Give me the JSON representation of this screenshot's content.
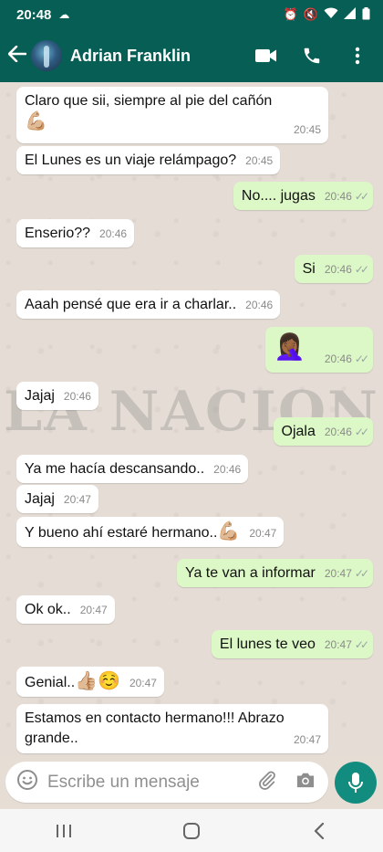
{
  "status_bar": {
    "time": "20:48"
  },
  "header": {
    "contact_name": "Adrian Franklin"
  },
  "watermark": "LA NACION",
  "messages": [
    {
      "dir": "in",
      "text": "Claro que sii, siempre al pie del cañón",
      "emoji": "💪🏼",
      "time": "20:45"
    },
    {
      "dir": "in",
      "text": "El Lunes es un viaje relámpago?",
      "time": "20:45"
    },
    {
      "dir": "out",
      "text": "No.... jugas",
      "time": "20:46"
    },
    {
      "dir": "in",
      "text": "Enserio??",
      "time": "20:46"
    },
    {
      "dir": "out",
      "text": "Si",
      "time": "20:46"
    },
    {
      "dir": "in",
      "text": "Aaah pensé que era ir a charlar..",
      "time": "20:46"
    },
    {
      "dir": "out",
      "emoji": "🤦🏾‍♀️",
      "time": "20:46"
    },
    {
      "dir": "in",
      "text": "Jajaj",
      "time": "20:46"
    },
    {
      "dir": "out",
      "text": "Ojala",
      "time": "20:46"
    },
    {
      "dir": "in",
      "text": "Ya me hacía descansando..",
      "time": "20:46"
    },
    {
      "dir": "in",
      "text": "Jajaj",
      "time": "20:47"
    },
    {
      "dir": "in",
      "text": "Y bueno ahí estaré hermano..",
      "emoji": "💪🏼",
      "time": "20:47"
    },
    {
      "dir": "out",
      "text": "Ya te van a informar",
      "time": "20:47"
    },
    {
      "dir": "in",
      "text": "Ok ok..",
      "time": "20:47"
    },
    {
      "dir": "out",
      "text": "El lunes te veo",
      "time": "20:47"
    },
    {
      "dir": "in",
      "text": "Genial..",
      "emoji": "👍🏼☺️",
      "time": "20:47"
    },
    {
      "dir": "in",
      "text": "Estamos en contacto hermano!!! Abrazo grande..",
      "time": "20:47"
    }
  ],
  "composer": {
    "placeholder": "Escribe un mensaje"
  },
  "colors": {
    "header": "#075e54",
    "outgoing": "#dcf8c6",
    "incoming": "#ffffff",
    "mic": "#128c7e",
    "chat_bg": "#e5ddd5"
  }
}
